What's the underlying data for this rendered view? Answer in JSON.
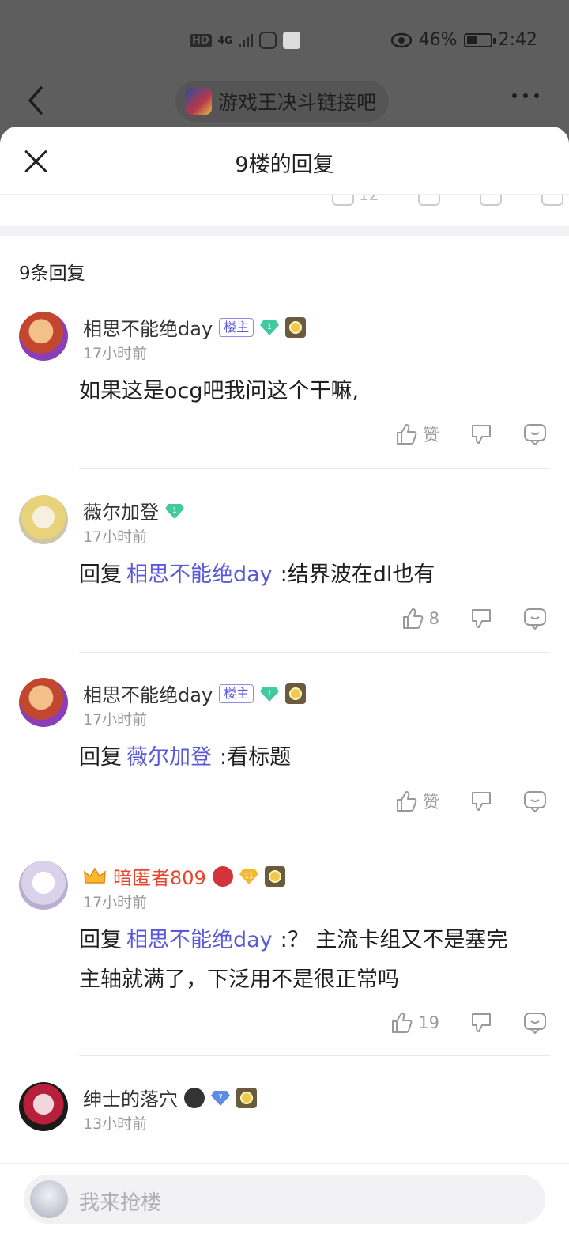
{
  "status_bar": {
    "hd": "HD",
    "network": "4G",
    "battery": "46%",
    "time": "2:42"
  },
  "top_nav": {
    "forum_name": "游戏王决斗链接吧"
  },
  "sheet": {
    "title": "9楼的回复",
    "peek_like_count": "12",
    "reply_count_label": "9条回复"
  },
  "replies": [
    {
      "username": "相思不能绝day",
      "owner_tag": "楼主",
      "level": "1",
      "time": "17小时前",
      "content": "如果这是ocg吧我问这个干嘛,",
      "likes": "赞"
    },
    {
      "username": "薇尔加登",
      "level": "1",
      "time": "17小时前",
      "reply_prefix": "回复",
      "reply_to": "相思不能绝day",
      "content": ":结界波在dl也有",
      "likes": "8"
    },
    {
      "username": "相思不能绝day",
      "owner_tag": "楼主",
      "level": "1",
      "time": "17小时前",
      "reply_prefix": "回复",
      "reply_to": "薇尔加登",
      "content": ":看标题",
      "likes": "赞"
    },
    {
      "username": "暗匿者809",
      "level": "11",
      "time": "17小时前",
      "reply_prefix": "回复",
      "reply_to": "相思不能绝day",
      "content_line1": ":？ 主流卡组又不是塞完",
      "content_line2": "主轴就满了，下泛用不是很正常吗",
      "likes": "19"
    },
    {
      "username": "绅士的落穴",
      "level": "7",
      "time": "13小时前"
    }
  ],
  "bottom_bar": {
    "placeholder": "我来抢楼"
  },
  "colors": {
    "accent": "#5a59d8",
    "vip_name": "#e8452c",
    "gem_green": "#43c9a0",
    "gem_blue": "#5b8de6",
    "gem_gold": "#f5b82e"
  }
}
